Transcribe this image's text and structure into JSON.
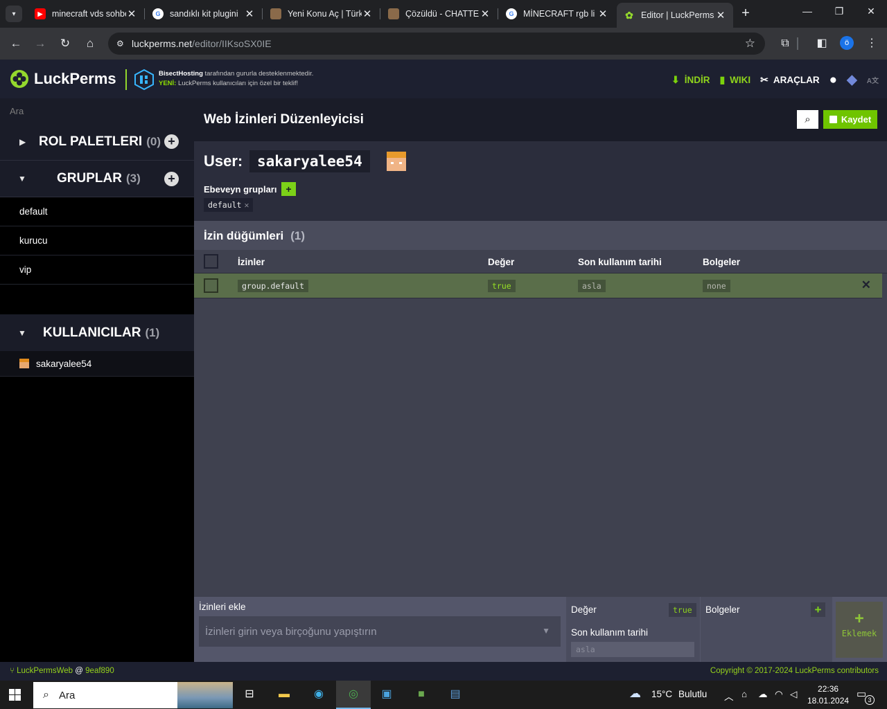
{
  "browser": {
    "tabs": [
      {
        "title": "minecraft vds sohbet",
        "favicon": "youtube-icon",
        "color": "#ff0000"
      },
      {
        "title": "sandıklı kit plugini",
        "favicon": "google-icon",
        "color": "#ffffff"
      },
      {
        "title": "Yeni Konu Aç | Türkçe",
        "favicon": "minecraft-forum-icon",
        "color": "#8a6a4a"
      },
      {
        "title": "Çözüldü - CHATTE",
        "favicon": "minecraft-forum-icon",
        "color": "#8a6a4a"
      },
      {
        "title": "MİNECRAFT rgb li",
        "favicon": "google-icon",
        "color": "#ffffff"
      },
      {
        "title": "Editor | LuckPerms",
        "favicon": "luckperms-icon",
        "color": "#94d82d",
        "active": true
      }
    ],
    "url_host": "luckperms.net",
    "url_path": "/editor/IIKsoSX0IE",
    "profile_initial": "ö"
  },
  "header": {
    "brand": "LuckPerms",
    "sponsor_name": "BisectHosting",
    "sponsor_text": " tarafından gururla desteklenmektedir.",
    "new_label": "YENİ:",
    "new_text": " LuckPerms kullanıcıları için özel bir teklif!",
    "nav": {
      "download": "İNDİR",
      "wiki": "WIKI",
      "tools": "ARAÇLAR"
    }
  },
  "sidebar": {
    "search_placeholder": "Ara",
    "role_palettes": {
      "label": "ROL PALETLERI",
      "count": "(0)"
    },
    "groups": {
      "label": "GRUPLAR",
      "count": "(3)",
      "items": [
        "default",
        "kurucu",
        "vip"
      ]
    },
    "users": {
      "label": "KULLANICILAR",
      "count": "(1)",
      "items": [
        "sakaryalee54"
      ]
    }
  },
  "editor": {
    "title": "Web İzinleri Düzenleyicisi",
    "save_label": "Kaydet",
    "user_label": "User:",
    "user_name": "sakaryalee54",
    "parents_label": "Ebeveyn grupları",
    "parent_groups": [
      "default"
    ],
    "nodes_title": "İzin düğümleri",
    "nodes_count": "(1)",
    "columns": {
      "permission": "İzinler",
      "value": "Değer",
      "expiry": "Son kullanım tarihi",
      "contexts": "Bolgeler"
    },
    "rows": [
      {
        "permission": "group.default",
        "value": "true",
        "expiry": "asla",
        "contexts": "none"
      }
    ]
  },
  "add_panel": {
    "label": "İzinleri ekle",
    "placeholder": "İzinleri girin veya birçoğunu yapıştırın",
    "value_label": "Değer",
    "value": "true",
    "expiry_label": "Son kullanım tarihi",
    "expiry_placeholder": "asla",
    "contexts_label": "Bolgeler",
    "add_label": "Eklemek"
  },
  "footer": {
    "app": "LuckPermsWeb",
    "at": " @ ",
    "commit": "9eaf890",
    "copyright": "Copyright © 2017-2024 LuckPerms contributors"
  },
  "taskbar": {
    "search": "Ara",
    "weather_temp": "15°C",
    "weather_text": "Bulutlu",
    "time": "22:36",
    "date": "18.01.2024",
    "notifications": "3"
  },
  "colors": {
    "accent": "#94d82d",
    "header_bg": "#1d2030",
    "row_bg": "#5a6e4a"
  }
}
